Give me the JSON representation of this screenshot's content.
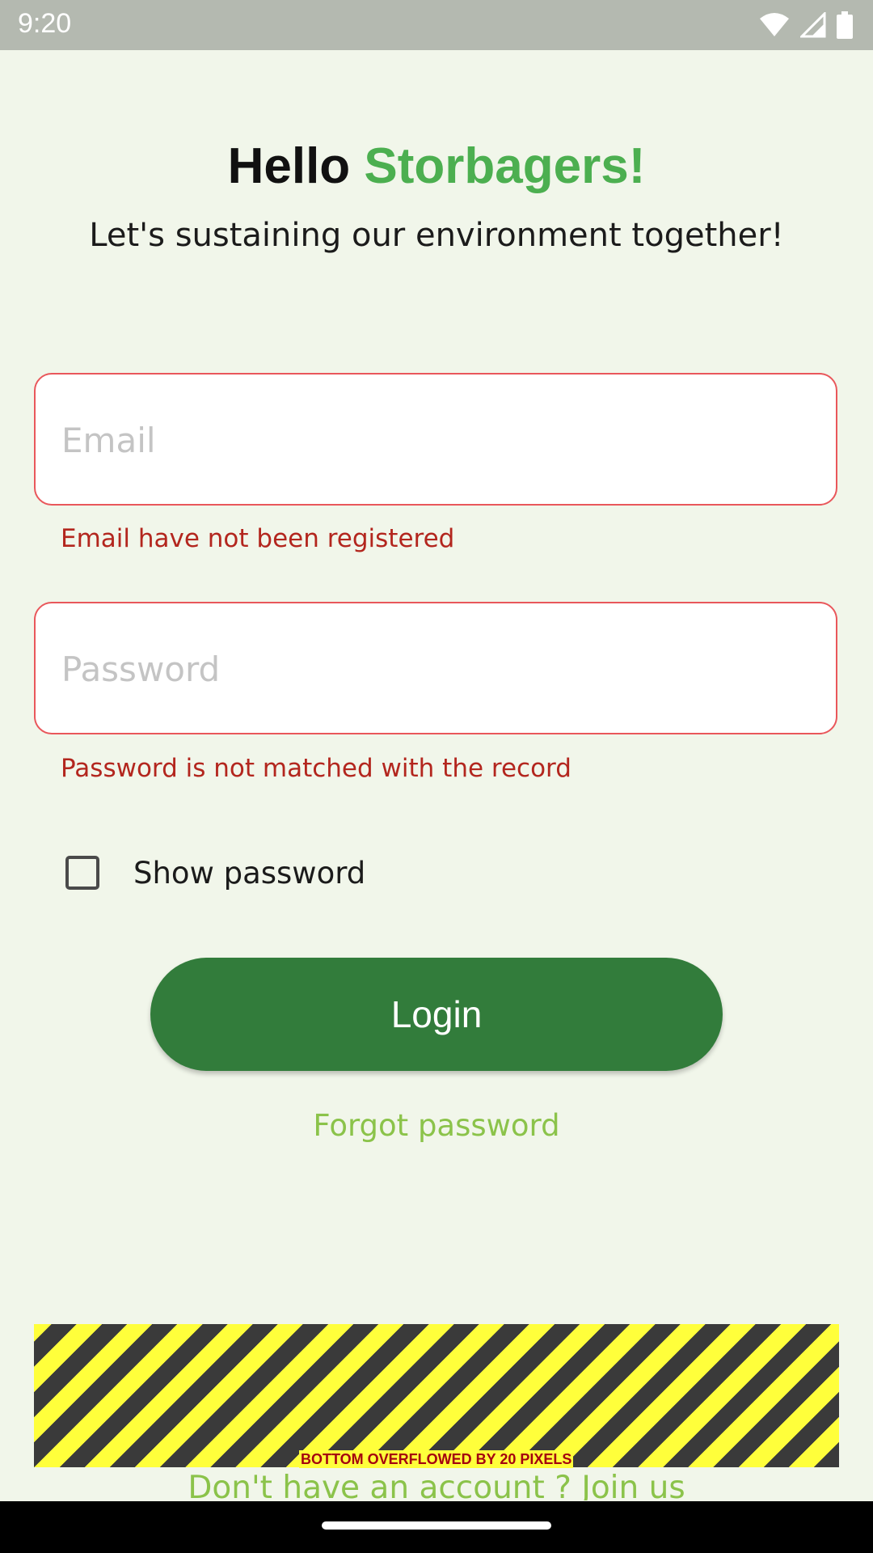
{
  "status_bar": {
    "time": "9:20",
    "icons": [
      "wifi-icon",
      "signal-icon",
      "battery-icon"
    ]
  },
  "header": {
    "greeting_prefix": "Hello",
    "greeting_name": "Storbagers!",
    "tagline": "Let's sustaining our environment together!"
  },
  "form": {
    "email": {
      "placeholder": "Email",
      "value": "",
      "error": "Email have not been registered"
    },
    "password": {
      "placeholder": "Password",
      "value": "",
      "error": "Password is not matched with the record"
    },
    "show_password": {
      "label": "Show password",
      "checked": false
    }
  },
  "actions": {
    "login_label": "Login",
    "forgot_label": "Forgot password",
    "join_label": "Don't have an account ? Join us"
  },
  "debug": {
    "overflow_label": "BOTTOM OVERFLOWED BY 20 PIXELS"
  },
  "colors": {
    "background": "#f1f6ea",
    "accent_green": "#4caf50",
    "button_green": "#327c3b",
    "link_green": "#8bc34a",
    "error_red": "#b3261e",
    "field_border": "#e9575b"
  }
}
